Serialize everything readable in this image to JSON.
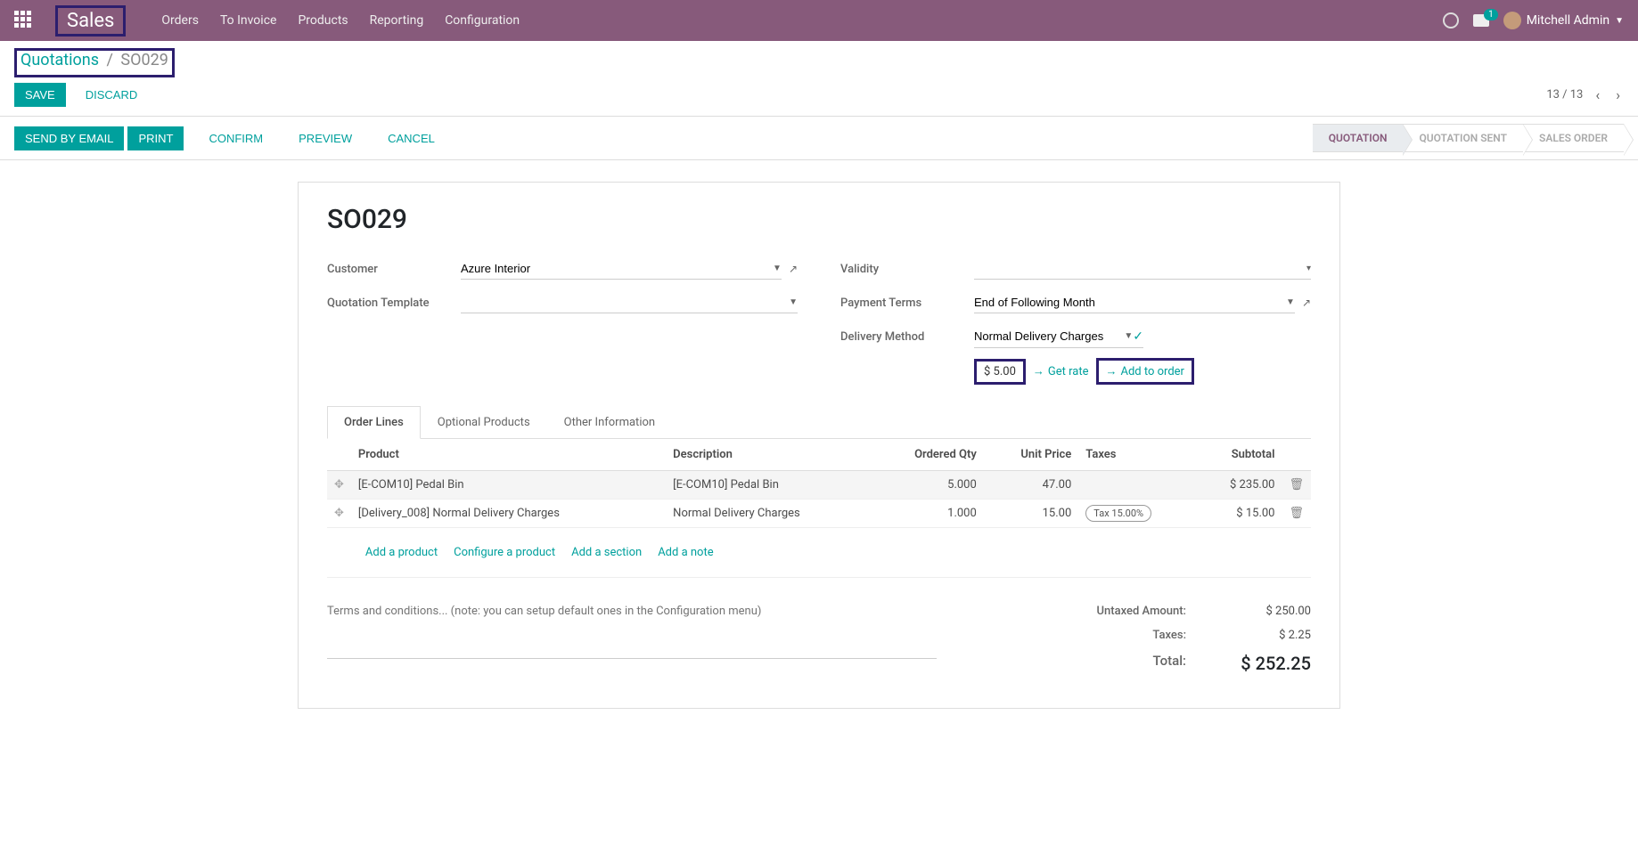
{
  "navbar": {
    "brand": "Sales",
    "menu": [
      "Orders",
      "To Invoice",
      "Products",
      "Reporting",
      "Configuration"
    ],
    "msg_badge": "1",
    "user": "Mitchell Admin"
  },
  "breadcrumb": {
    "parent": "Quotations",
    "current": "SO029"
  },
  "cp": {
    "save": "SAVE",
    "discard": "DISCARD",
    "pager": "13 / 13"
  },
  "actions": {
    "send_email": "SEND BY EMAIL",
    "print": "PRINT",
    "confirm": "CONFIRM",
    "preview": "PREVIEW",
    "cancel": "CANCEL"
  },
  "status": {
    "quotation": "QUOTATION",
    "sent": "QUOTATION SENT",
    "order": "SALES ORDER"
  },
  "form": {
    "title": "SO029",
    "labels": {
      "customer": "Customer",
      "template": "Quotation Template",
      "validity": "Validity",
      "payment_terms": "Payment Terms",
      "delivery_method": "Delivery Method"
    },
    "customer": "Azure Interior",
    "template": "",
    "validity": "",
    "payment_terms": "End of Following Month",
    "delivery_method": "Normal Delivery Charges",
    "rate": "$ 5.00",
    "get_rate": "Get rate",
    "add_to_order": "Add to order"
  },
  "tabs": {
    "order_lines": "Order Lines",
    "optional": "Optional Products",
    "other": "Other Information"
  },
  "columns": {
    "product": "Product",
    "description": "Description",
    "qty": "Ordered Qty",
    "unit_price": "Unit Price",
    "taxes": "Taxes",
    "subtotal": "Subtotal"
  },
  "lines": [
    {
      "product": "[E-COM10] Pedal Bin",
      "description": "[E-COM10] Pedal Bin",
      "qty": "5.000",
      "unit_price": "47.00",
      "taxes": "",
      "subtotal": "$ 235.00"
    },
    {
      "product": "[Delivery_008] Normal Delivery Charges",
      "description": "Normal Delivery Charges",
      "qty": "1.000",
      "unit_price": "15.00",
      "taxes": "Tax 15.00%",
      "subtotal": "$ 15.00"
    }
  ],
  "add_links": {
    "product": "Add a product",
    "configure": "Configure a product",
    "section": "Add a section",
    "note": "Add a note"
  },
  "terms_placeholder": "Terms and conditions... (note: you can setup default ones in the Configuration menu)",
  "totals": {
    "untaxed_label": "Untaxed Amount:",
    "untaxed": "$ 250.00",
    "taxes_label": "Taxes:",
    "taxes": "$ 2.25",
    "total_label": "Total:",
    "total": "$ 252.25"
  }
}
